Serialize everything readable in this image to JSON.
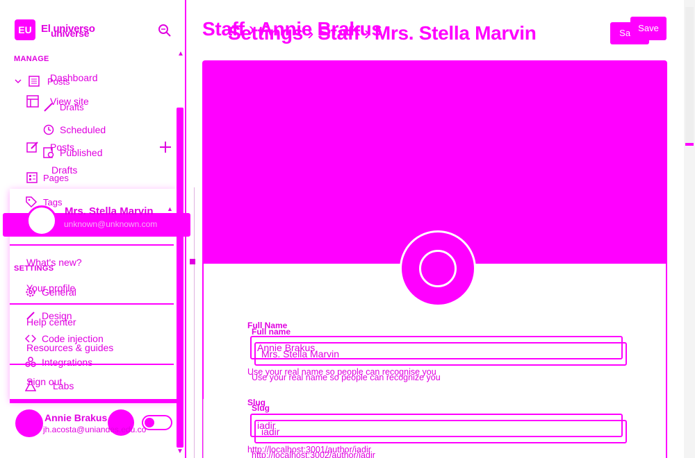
{
  "brand": {
    "logo_text": "EU",
    "name": "El universo",
    "name_echo": "universe"
  },
  "sidebar": {
    "manage_label": "MANAGE",
    "settings_label": "SETTINGS",
    "items": [
      {
        "label": "Dashboard",
        "icon": "dashboard-icon"
      },
      {
        "label": "Posts",
        "icon": "posts-icon"
      },
      {
        "label": "View site",
        "icon": "layout-icon"
      },
      {
        "label": "Drafts",
        "icon": "pen-icon"
      },
      {
        "label": "Scheduled",
        "icon": "clock-icon"
      },
      {
        "label": "Posts",
        "icon": "edit-icon"
      },
      {
        "label": "Published",
        "icon": "published-icon"
      },
      {
        "label": "Drafts"
      },
      {
        "label": "Pages",
        "icon": "pages-icon"
      },
      {
        "label": "Tags",
        "icon": "tag-icon"
      },
      {
        "label": "General",
        "icon": "gear-icon"
      },
      {
        "label": "Design",
        "icon": "brush-icon"
      },
      {
        "label": "Code injection",
        "icon": "code-icon"
      },
      {
        "label": "Integrations",
        "icon": "puzzle-icon"
      },
      {
        "label": "Labs",
        "icon": "flask-icon"
      }
    ]
  },
  "popup": {
    "name": "Mrs. Stella Marvin",
    "email": "unknown@unknown.com",
    "links": [
      "What's new?",
      "Your profile",
      "Help center",
      "Resources & guides",
      "Sign out"
    ]
  },
  "footer_user": {
    "name": "Annie Brakus",
    "email": "jh.acosta@uniandes.edu.co"
  },
  "header": {
    "breadcrumb_a": [
      "Staff",
      "Annie Brakus"
    ],
    "breadcrumb_b": [
      "Settings",
      "Staff",
      "Mrs. Stella Marvin"
    ],
    "save_label": "Save",
    "save_label_b": "Save"
  },
  "form": {
    "fullname_label_a": "Full Name",
    "fullname_label_b": "Full name",
    "fullname_value_a": "Annie Brakus",
    "fullname_value_b": "Mrs. Stella Marvin",
    "fullname_hint_a": "Use your real name so people can recognise you",
    "fullname_hint_b": "Use your real name so people can recognize you",
    "slug_label_a": "Slug",
    "slug_label_b": "Slug",
    "slug_value_a": "iadir",
    "slug_value_b": "iadir",
    "slug_url_a": "http://localhost:3001/author/iadir",
    "slug_url_b": "http://localhost:3002/author/iadir"
  },
  "colors": {
    "accent": "#ff00ff"
  }
}
